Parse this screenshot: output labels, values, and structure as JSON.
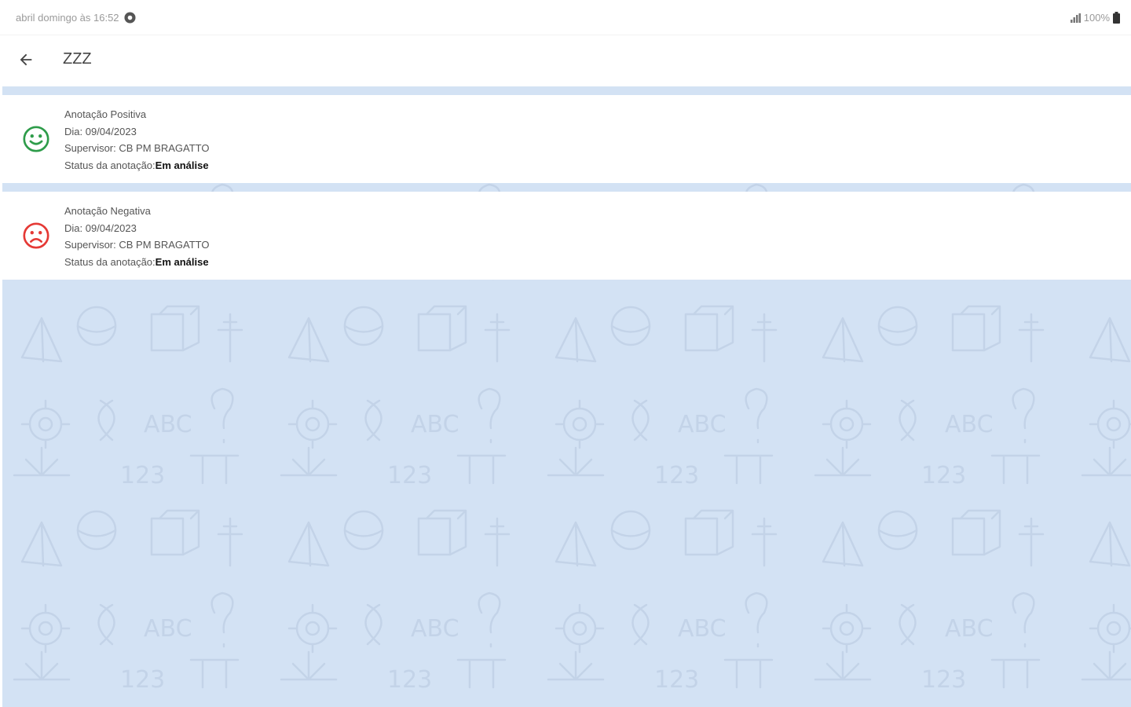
{
  "status_bar": {
    "left_text": "abril domingo às 16:52",
    "battery": "100%"
  },
  "header": {
    "title": "ZZZ"
  },
  "annotations": [
    {
      "type": "Anotação Positiva",
      "date_label": "Dia: 09/04/2023",
      "supervisor": "Supervisor: CB PM BRAGATTO",
      "status_label": "Status da anotação:",
      "status_value": "Em análise",
      "icon": "smiley-happy-icon",
      "icon_color": "#2e9c4a"
    },
    {
      "type": "Anotação Negativa",
      "date_label": "Dia: 09/04/2023",
      "supervisor": "Supervisor: CB PM BRAGATTO",
      "status_label": "Status da anotação:",
      "status_value": "Em análise",
      "icon": "smiley-sad-icon",
      "icon_color": "#e53935"
    }
  ],
  "colors": {
    "background_pattern": "#d3e2f4",
    "card": "#ffffff"
  }
}
